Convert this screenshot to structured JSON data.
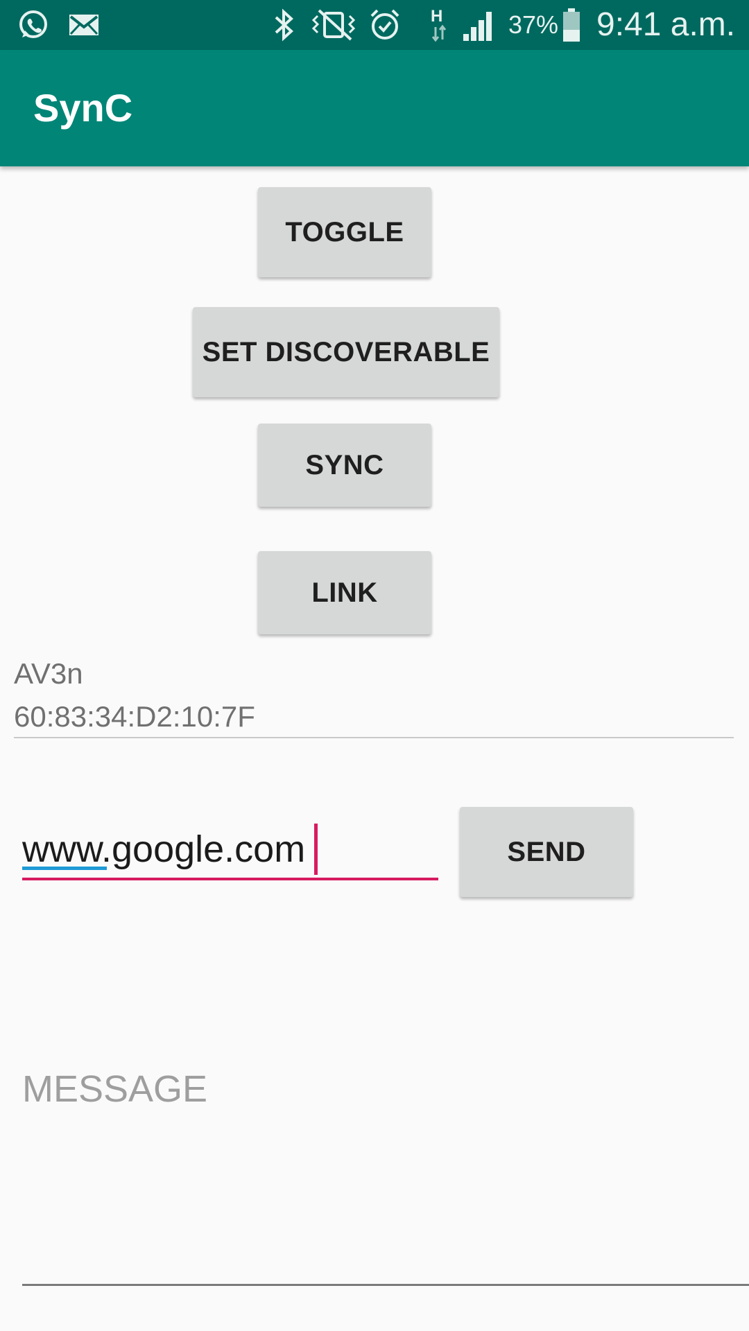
{
  "status_bar": {
    "left_icons": [
      "whatsapp-icon",
      "mail-icon"
    ],
    "right_icons": [
      "bluetooth-icon",
      "vibrate-icon",
      "alarm-icon",
      "network-h-icon",
      "signal-icon",
      "battery-icon"
    ],
    "battery": "37%",
    "time": "9:41 a.m."
  },
  "app_bar": {
    "title": "SynC"
  },
  "buttons": {
    "toggle": "TOGGLE",
    "set_discoverable": "SET DISCOVERABLE",
    "sync": "SYNC",
    "link": "LINK",
    "send": "SEND"
  },
  "device": {
    "name": "AV3n",
    "address": "60:83:34:D2:10:7F"
  },
  "url_input": {
    "value": "www.google.com"
  },
  "message_input": {
    "placeholder": "MESSAGE"
  },
  "colors": {
    "status_bar": "#00695f",
    "app_bar": "#008577",
    "accent": "#d81b60",
    "button": "#d6d7d7"
  }
}
